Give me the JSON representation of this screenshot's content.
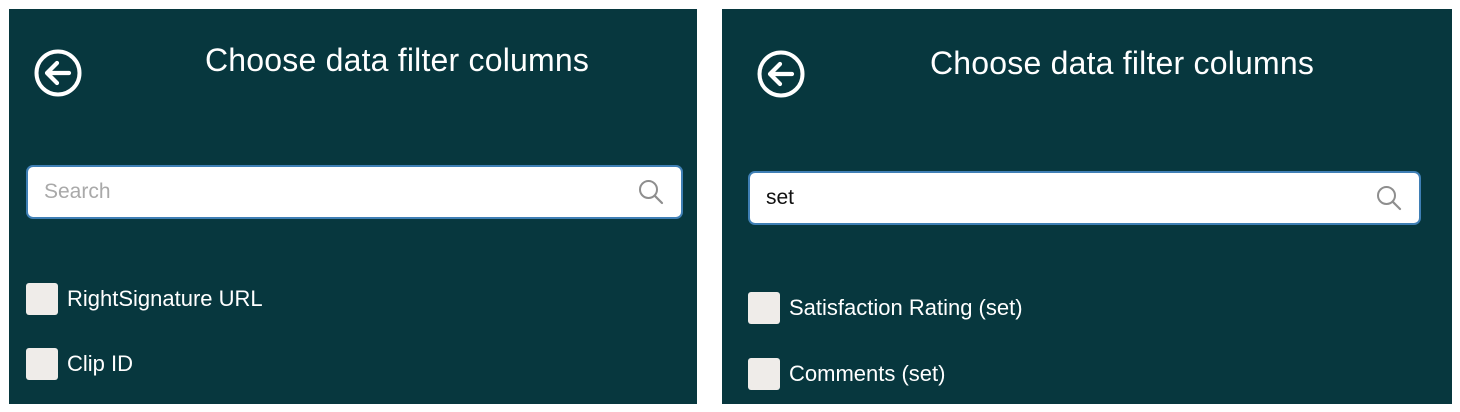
{
  "panels": [
    {
      "title": "Choose data filter columns",
      "back_icon": "arrow-left-circle-icon",
      "search": {
        "value": "",
        "placeholder": "Search",
        "icon": "magnifier-icon"
      },
      "options": [
        {
          "label": "RightSignature URL",
          "checked": false
        },
        {
          "label": "Clip ID",
          "checked": false
        }
      ]
    },
    {
      "title": "Choose data filter columns",
      "back_icon": "arrow-left-circle-icon",
      "search": {
        "value": "set",
        "placeholder": "Search",
        "icon": "magnifier-icon"
      },
      "options": [
        {
          "label": "Satisfaction Rating (set)",
          "checked": false
        },
        {
          "label": "Comments (set)",
          "checked": false
        }
      ]
    }
  ],
  "colors": {
    "panel_bg": "#07373e",
    "search_border": "#3f7fb5",
    "checkbox_bg": "#efece9",
    "text": "#ffffff",
    "placeholder": "#a9a9a9"
  }
}
